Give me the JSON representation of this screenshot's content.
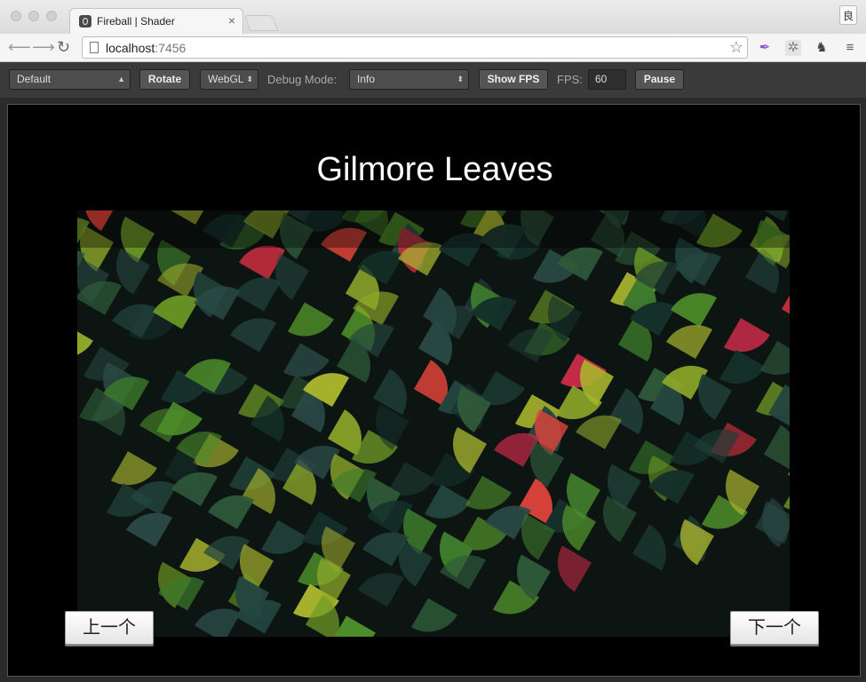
{
  "browser": {
    "tab_title": "Fireball | Shader",
    "tab_close": "×",
    "profile_char": "良",
    "url_host": "localhost",
    "url_port": ":7456",
    "icons": [
      "back-icon",
      "forward-icon",
      "reload-icon",
      "page-icon",
      "star-icon",
      "feather-icon",
      "react-icon",
      "elephant-icon",
      "menu-icon"
    ]
  },
  "toolbar": {
    "template_select": "Default",
    "rotate_label": "Rotate",
    "renderer_select": "WebGL",
    "debug_mode_label": "Debug Mode:",
    "debug_mode_select": "Info",
    "show_fps_label": "Show FPS",
    "fps_label": "FPS:",
    "fps_value": "60",
    "pause_label": "Pause"
  },
  "scene": {
    "title": "Gilmore Leaves",
    "prev_label": "上一个",
    "next_label": "下一个"
  },
  "colors": {
    "accent_green": "#4e8a2a",
    "accent_red": "#d9303a",
    "leaf_dark": "#1f4a3f",
    "leaf_yellow": "#9aae2b"
  }
}
